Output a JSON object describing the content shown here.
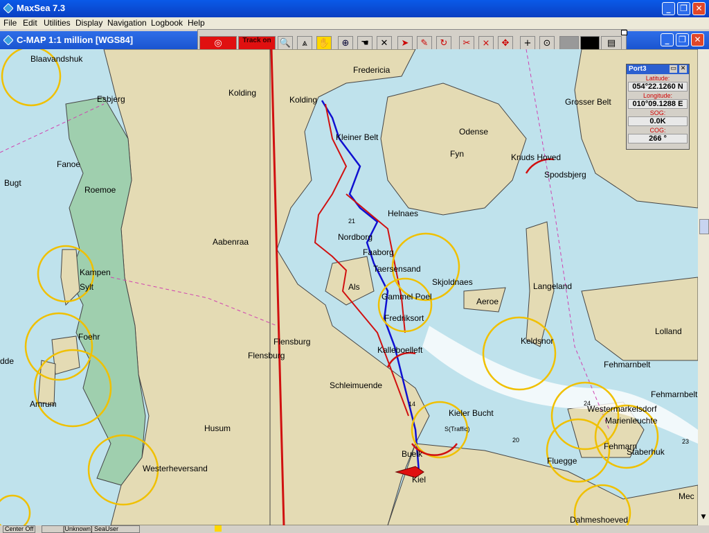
{
  "app": {
    "title": "MaxSea 7.3"
  },
  "menu": [
    "File",
    "Edit",
    "Utilities",
    "Display",
    "Navigation",
    "Logbook",
    "Help"
  ],
  "chart_window": {
    "title": "C-MAP  1:1 million [WGS84]"
  },
  "toolbar": {
    "track_label": "Track on"
  },
  "port_panel": {
    "title": "Port3",
    "latitude_label": "Latitude:",
    "latitude_value": "054°22.1260 N",
    "longitude_label": "Longitude:",
    "longitude_value": "010°09.1288 E",
    "sog_label": "SOG:",
    "sog_value": "0.0K",
    "cog_label": "COG:",
    "cog_value": "266 °"
  },
  "places": [
    "Blaavandshuk",
    "Esbjerg",
    "Kolding",
    "Fredericia",
    "Grosser Belt",
    "Kolding",
    "Odense",
    "Fyn",
    "Kleiner Belt",
    "Knuds Hoved",
    "Spodsbjerg",
    "Fanoe",
    "Bugt",
    "Roemoe",
    "Helnaes",
    "Aabenraa",
    "Nordborg",
    "Faaborg",
    "Kampen",
    "Sylt",
    "Taersensand",
    "Skjoldnaes",
    "Langeland",
    "Als",
    "Gammel Poel",
    "Aeroe",
    "Fredriksort",
    "Keldsnor",
    "Lolland",
    "Foehr",
    "Flensburg",
    "Flensburg",
    "Kalleboelleft",
    "Fehmarnbelt",
    "Fehmarnbelt",
    "dde",
    "Amrum",
    "Schleimuende",
    "Westermarkelsdorf",
    "Marienleuchte",
    "Kieler Bucht",
    "Husum",
    "Fehmarn",
    "Staberhuk",
    "Buelk",
    "Fluegge",
    "Westerheversand",
    "Kiel",
    "Mec",
    "Dahmeshoeved"
  ],
  "map_labels": {
    "traffic": "S(Traffic)",
    "depth_14": "14",
    "depth_20": "20",
    "depth_23": "23",
    "depth_21": "21",
    "depth_24": "24"
  },
  "status": {
    "seg1": "Center Off",
    "seg2": "[Unknown] SeaUser"
  }
}
